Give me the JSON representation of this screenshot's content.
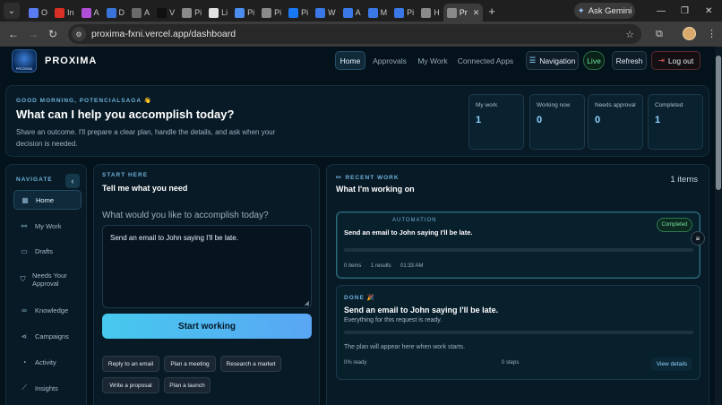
{
  "browser": {
    "tabs": [
      {
        "label": "O",
        "color": "#5b7cf0"
      },
      {
        "label": "In",
        "color": "#d93025"
      },
      {
        "label": "A",
        "color": "#b04fd6"
      },
      {
        "label": "D",
        "color": "#3a73d9"
      },
      {
        "label": "A",
        "color": "#6a6a6a"
      },
      {
        "label": "V",
        "color": "#101010"
      },
      {
        "label": "Pi",
        "color": "#8a8a8a"
      },
      {
        "label": "Li",
        "color": "#e0e0e0"
      },
      {
        "label": "Pi",
        "color": "#4c8df0"
      },
      {
        "label": "Pi",
        "color": "#8a8a8a"
      },
      {
        "label": "Pi",
        "color": "#1877f2"
      },
      {
        "label": "W",
        "color": "#3b78e7"
      },
      {
        "label": "A",
        "color": "#3b78e7"
      },
      {
        "label": "M",
        "color": "#3b78e7"
      },
      {
        "label": "Pi",
        "color": "#3b78e7"
      },
      {
        "label": "H",
        "color": "#8a8a8a"
      }
    ],
    "active_tab": {
      "label": "Pr",
      "close": "✕"
    },
    "new_tab": "+",
    "gemini_label": "Ask Gemini",
    "url": "proxima-fxni.vercel.app/dashboard"
  },
  "header": {
    "brand": "PROXIMA",
    "logo_text": "PROXIMA",
    "nav": [
      "Home",
      "Approvals",
      "My Work",
      "Connected Apps"
    ],
    "navigation_btn": "Navigation",
    "live": "Live",
    "refresh": "Refresh",
    "logout": "Log out"
  },
  "hero": {
    "greeting": "GOOD MORNING, POTENCIALSAGA 👋",
    "question": "What can I help you accomplish today?",
    "subtitle": "Share an outcome. I'll prepare a clear plan, handle the details, and ask when your decision is needed.",
    "stats": [
      {
        "label": "My work",
        "value": "1"
      },
      {
        "label": "Working now",
        "value": "0"
      },
      {
        "label": "Needs approval",
        "value": "0"
      },
      {
        "label": "Completed",
        "value": "1"
      }
    ]
  },
  "sidebar": {
    "title": "NAVIGATE",
    "collapse": "‹",
    "items": [
      {
        "label": "Home",
        "icon": "grid-icon",
        "glyph": "▦"
      },
      {
        "label": "My Work",
        "icon": "link-icon",
        "glyph": "⚯"
      },
      {
        "label": "Drafts",
        "icon": "file-icon",
        "glyph": "▭"
      },
      {
        "label": "Needs Your Approval",
        "icon": "shield-icon",
        "glyph": "⛉"
      },
      {
        "label": "Knowledge",
        "icon": "book-icon",
        "glyph": "∞"
      },
      {
        "label": "Campaigns",
        "icon": "share-icon",
        "glyph": "⋖"
      },
      {
        "label": "Activity",
        "icon": "clock-icon",
        "glyph": "◔"
      },
      {
        "label": "Insights",
        "icon": "chart-icon",
        "glyph": "⟋"
      }
    ]
  },
  "compose": {
    "kicker": "START HERE",
    "heading": "Tell me what you need",
    "prompt": "What would you like to accomplish today?",
    "input_value": "Send an email to John saying I'll be late.",
    "start_button": "Start working",
    "chips": [
      "Reply to an email",
      "Plan a meeting",
      "Research a market",
      "Write a proposal",
      "Plan a launch"
    ]
  },
  "recent": {
    "kicker": "RECENT WORK",
    "heading": "What I'm working on",
    "count": "1 items",
    "item1": {
      "badge": "AUTOMATION",
      "title": "Send an email to John saying I'll be late.",
      "status": "Completed",
      "progress": 1.0,
      "items": "0 items",
      "results": "1 results",
      "time": "01:33 AM"
    },
    "item2": {
      "label": "DONE 🎉",
      "title": "Send an email to John saying I'll be late.",
      "subtitle": "Everything for this request is ready.",
      "plan_note": "The plan will appear here when work starts.",
      "progress": 0.0,
      "ready": "0% ready",
      "steps": "0 steps",
      "view": "View details"
    }
  },
  "colors": {
    "accent": "#46c9ee",
    "live": "#6fe39a",
    "logout": "#e05a5a"
  }
}
